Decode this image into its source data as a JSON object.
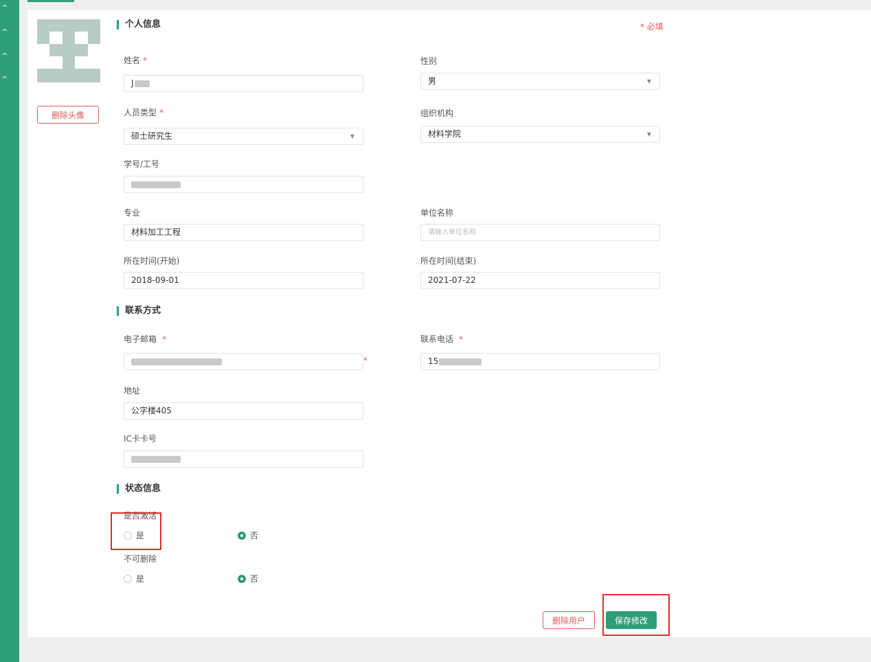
{
  "colors": {
    "accent": "#2e9e77",
    "danger": "#e05a5a",
    "highlight": "#e02a2a"
  },
  "avatar": {
    "delete_label": "删除头像"
  },
  "sections": {
    "personal": "个人信息",
    "contact": "联系方式",
    "status": "状态信息"
  },
  "required_note": "* 必填",
  "fields": {
    "name": {
      "label": "姓名",
      "value": "J"
    },
    "gender": {
      "label": "性别",
      "value": "男"
    },
    "person_type": {
      "label": "人员类型",
      "value": "硕士研究生"
    },
    "org": {
      "label": "组织机构",
      "value": "材料学院"
    },
    "student_id": {
      "label": "学号/工号",
      "value": ""
    },
    "major": {
      "label": "专业",
      "value": "材料加工工程"
    },
    "unit_name": {
      "label": "单位名称",
      "placeholder": "请输入单位名称"
    },
    "time_start": {
      "label": "所在时间(开始)",
      "value": "2018-09-01"
    },
    "time_end": {
      "label": "所在时间(结束)",
      "value": "2021-07-22"
    },
    "email": {
      "label": "电子邮箱",
      "value": ""
    },
    "phone": {
      "label": "联系电话",
      "value": "15"
    },
    "address": {
      "label": "地址",
      "value": "公字楼405"
    },
    "ic_card": {
      "label": "IC卡卡号",
      "value": ""
    }
  },
  "status": {
    "active": {
      "label": "是否激活",
      "yes": "是",
      "no": "否",
      "selected": "no"
    },
    "undeletable": {
      "label": "不可删除",
      "yes": "是",
      "no": "否",
      "selected": "no"
    }
  },
  "actions": {
    "delete_user": "删除用户",
    "save": "保存修改"
  }
}
